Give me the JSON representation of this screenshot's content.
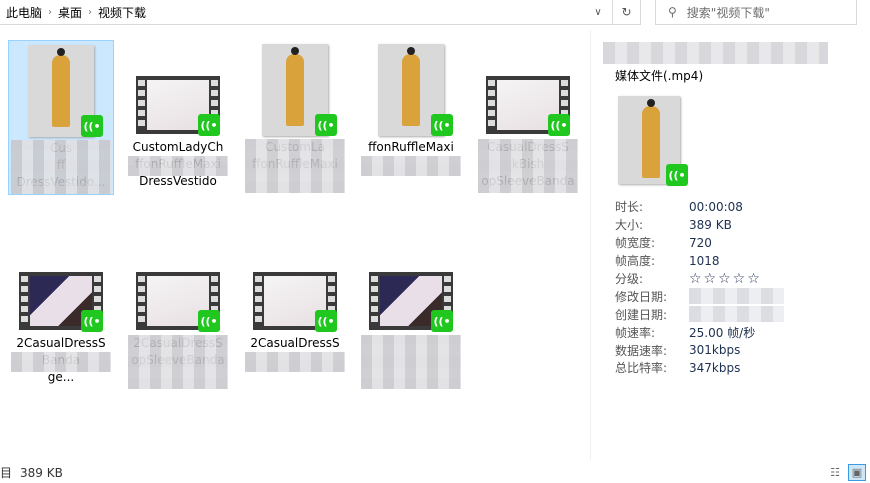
{
  "address": {
    "crumbs": [
      "此电脑",
      "桌面",
      "视频下载"
    ]
  },
  "search": {
    "placeholder": "搜索\"视频下载\""
  },
  "files": [
    {
      "kind": "portrait",
      "lines": [
        "",
        "Cus",
        "ff",
        "DressVestido..."
      ],
      "selected": true
    },
    {
      "kind": "video",
      "lines": [
        "CustomLadyCh",
        "ffonRuffleMaxi",
        "DressVestido"
      ],
      "selected": false
    },
    {
      "kind": "portrait",
      "lines": [
        "CustomLa",
        "ffonRuffleMaxi",
        ""
      ],
      "selected": false
    },
    {
      "kind": "portrait",
      "lines": [
        "",
        "ffonRuffleMaxi",
        ""
      ],
      "selected": false
    },
    {
      "kind": "video",
      "lines": [
        "CasualDressS",
        "kBish",
        "opSleeveBanda"
      ],
      "selected": false
    },
    {
      "kind": "video-dark",
      "lines": [
        "2CasualDressS",
        "Banda",
        "ge..."
      ],
      "selected": false
    },
    {
      "kind": "video",
      "lines": [
        "2CasualDressS",
        "",
        "opSleeveBanda"
      ],
      "selected": false
    },
    {
      "kind": "video",
      "lines": [
        "2CasualDressS",
        "",
        ""
      ],
      "selected": false
    },
    {
      "kind": "video-dark",
      "lines": [
        "",
        "",
        ""
      ],
      "selected": false
    }
  ],
  "details": {
    "type": "媒体文件(.mp4)",
    "props": [
      {
        "k": "时长:",
        "v": "00:00:08"
      },
      {
        "k": "大小:",
        "v": "389 KB"
      },
      {
        "k": "帧宽度:",
        "v": "720"
      },
      {
        "k": "帧高度:",
        "v": "1018"
      },
      {
        "k": "分级:",
        "v": "☆☆☆☆☆"
      },
      {
        "k": "修改日期:",
        "v": ""
      },
      {
        "k": "创建日期:",
        "v": ""
      },
      {
        "k": "帧速率:",
        "v": "25.00 帧/秒"
      },
      {
        "k": "数据速率:",
        "v": "301kbps"
      },
      {
        "k": "总比特率:",
        "v": "347kbps"
      }
    ],
    "rating": 0
  },
  "status": {
    "selected": "目",
    "size": "389 KB"
  },
  "colors": {
    "badge": "#1fc71f",
    "selection": "#cce8ff"
  }
}
